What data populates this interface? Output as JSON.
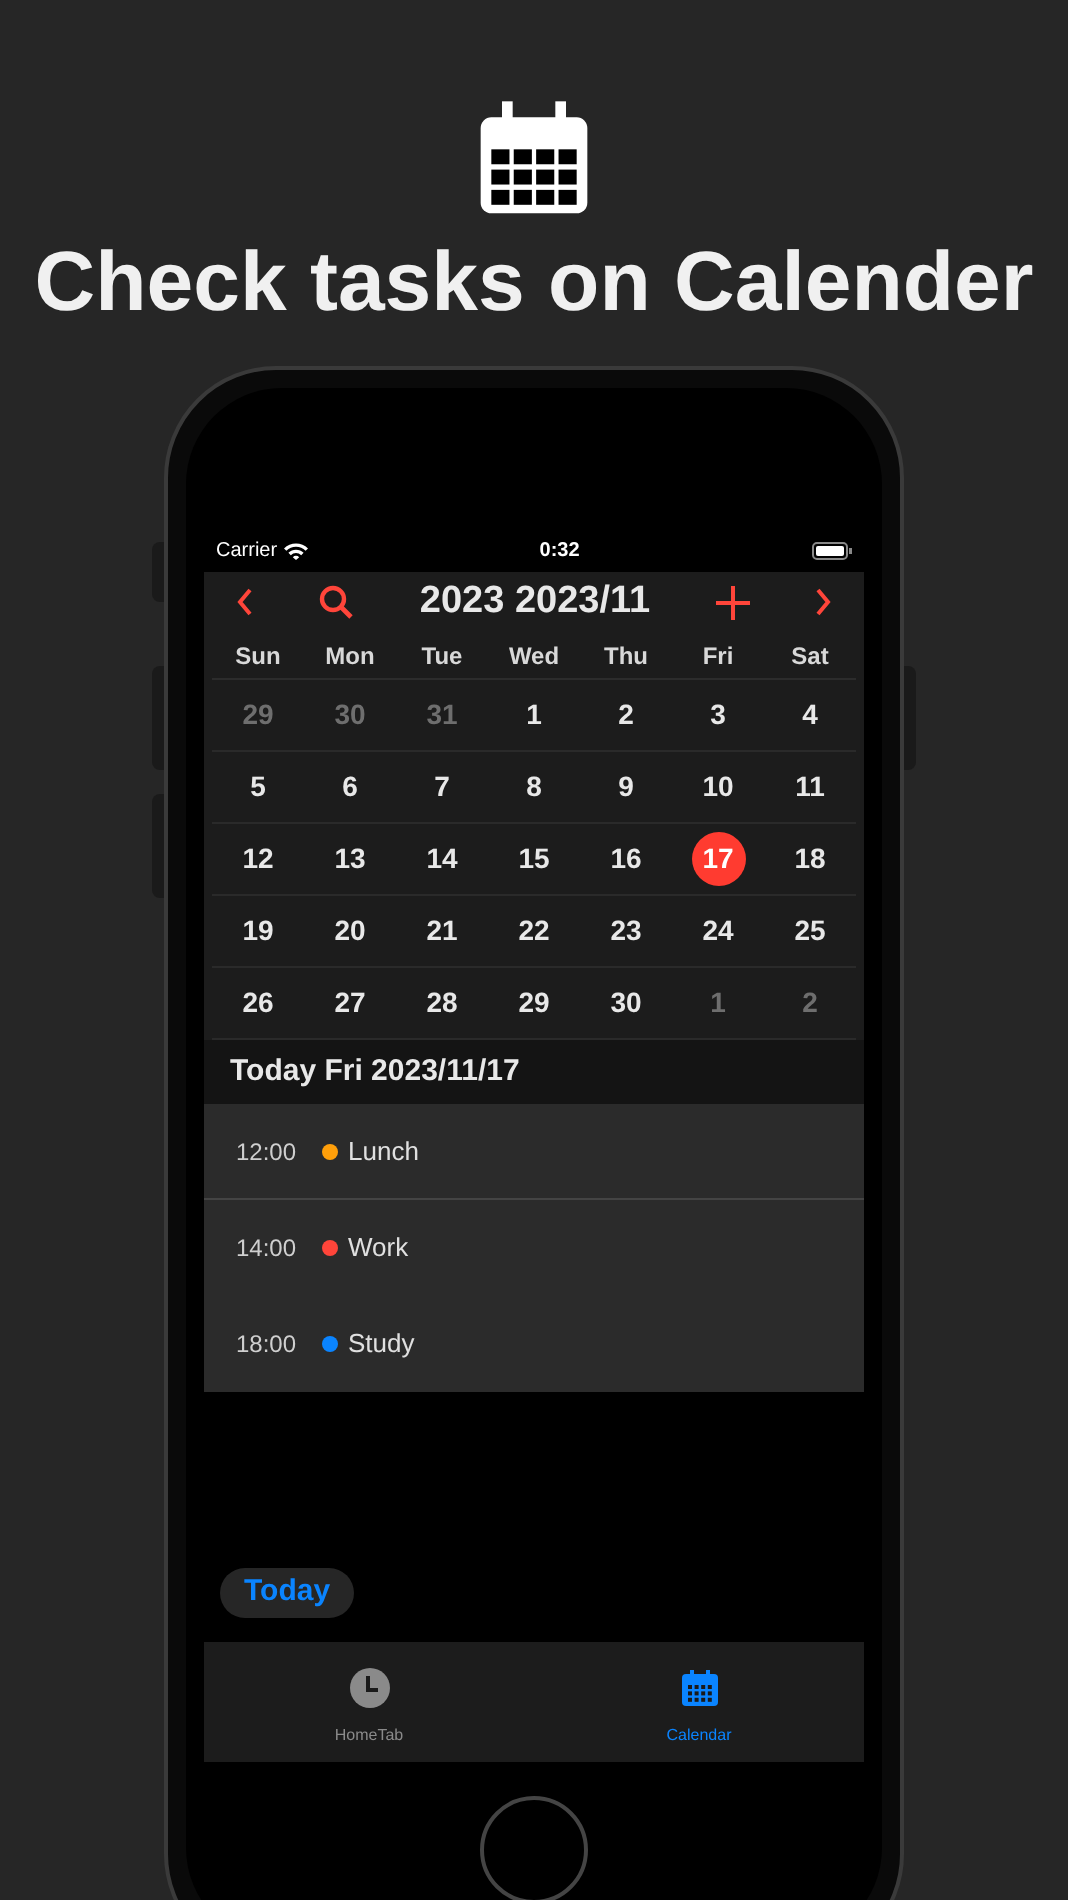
{
  "headline": "Check tasks on Calender",
  "status_bar": {
    "carrier": "Carrier",
    "time": "0:32"
  },
  "calendar": {
    "title": "2023 2023/11",
    "weekdays": [
      "Sun",
      "Mon",
      "Tue",
      "Wed",
      "Thu",
      "Fri",
      "Sat"
    ],
    "weeks": [
      [
        {
          "day": "29",
          "muted": true,
          "selected": false
        },
        {
          "day": "30",
          "muted": true,
          "selected": false
        },
        {
          "day": "31",
          "muted": true,
          "selected": false
        },
        {
          "day": "1",
          "muted": false,
          "selected": false
        },
        {
          "day": "2",
          "muted": false,
          "selected": false
        },
        {
          "day": "3",
          "muted": false,
          "selected": false
        },
        {
          "day": "4",
          "muted": false,
          "selected": false
        }
      ],
      [
        {
          "day": "5",
          "muted": false,
          "selected": false
        },
        {
          "day": "6",
          "muted": false,
          "selected": false
        },
        {
          "day": "7",
          "muted": false,
          "selected": false
        },
        {
          "day": "8",
          "muted": false,
          "selected": false
        },
        {
          "day": "9",
          "muted": false,
          "selected": false
        },
        {
          "day": "10",
          "muted": false,
          "selected": false
        },
        {
          "day": "11",
          "muted": false,
          "selected": false
        }
      ],
      [
        {
          "day": "12",
          "muted": false,
          "selected": false
        },
        {
          "day": "13",
          "muted": false,
          "selected": false
        },
        {
          "day": "14",
          "muted": false,
          "selected": false
        },
        {
          "day": "15",
          "muted": false,
          "selected": false
        },
        {
          "day": "16",
          "muted": false,
          "selected": false
        },
        {
          "day": "17",
          "muted": false,
          "selected": true
        },
        {
          "day": "18",
          "muted": false,
          "selected": false
        }
      ],
      [
        {
          "day": "19",
          "muted": false,
          "selected": false
        },
        {
          "day": "20",
          "muted": false,
          "selected": false
        },
        {
          "day": "21",
          "muted": false,
          "selected": false
        },
        {
          "day": "22",
          "muted": false,
          "selected": false
        },
        {
          "day": "23",
          "muted": false,
          "selected": false
        },
        {
          "day": "24",
          "muted": false,
          "selected": false
        },
        {
          "day": "25",
          "muted": false,
          "selected": false
        }
      ],
      [
        {
          "day": "26",
          "muted": false,
          "selected": false
        },
        {
          "day": "27",
          "muted": false,
          "selected": false
        },
        {
          "day": "28",
          "muted": false,
          "selected": false
        },
        {
          "day": "29",
          "muted": false,
          "selected": false
        },
        {
          "day": "30",
          "muted": false,
          "selected": false
        },
        {
          "day": "1",
          "muted": true,
          "selected": false
        },
        {
          "day": "2",
          "muted": true,
          "selected": false
        }
      ]
    ]
  },
  "day_header": "Today Fri 2023/11/17",
  "events": [
    {
      "time": "12:00",
      "title": "Lunch",
      "color": "#ff9f0a"
    },
    {
      "time": "14:00",
      "title": "Work",
      "color": "#ff453a"
    },
    {
      "time": "18:00",
      "title": "Study",
      "color": "#0a84ff"
    }
  ],
  "today_button": "Today",
  "tabs": [
    {
      "label": "HomeTab",
      "kind": "clock",
      "selected": false
    },
    {
      "label": "Calendar",
      "kind": "calendar",
      "selected": true
    }
  ]
}
